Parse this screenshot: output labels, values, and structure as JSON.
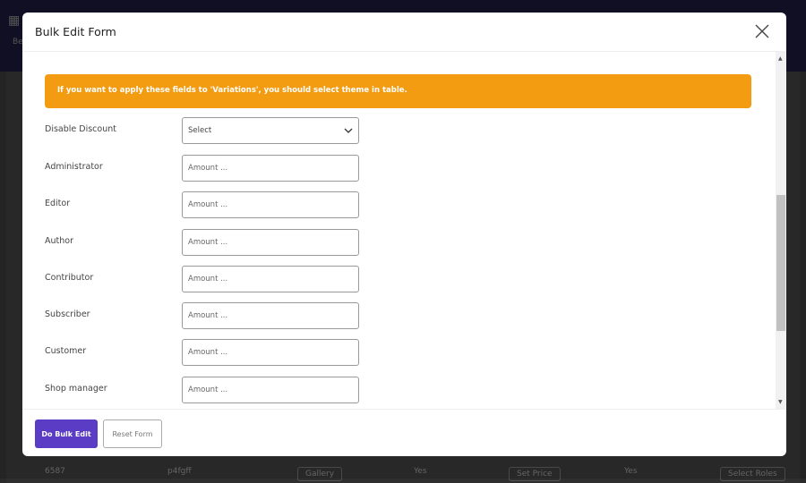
{
  "background": {
    "toolbar_label": "Be",
    "row": {
      "id": "6587",
      "name": "p4fgff",
      "gallery": "Gallery",
      "yes1": "Yes",
      "set_price": "Set Price",
      "yes2": "Yes",
      "select_roles": "Select Roles"
    }
  },
  "modal": {
    "title": "Bulk Edit Form",
    "alert": "If you want to apply these fields to 'Variations', you should select theme in table.",
    "alert_color": "#f39c12",
    "fields": [
      {
        "label": "Disable Discount",
        "type": "select",
        "value": "Select"
      },
      {
        "label": "Administrator",
        "placeholder": "Amount ..."
      },
      {
        "label": "Editor",
        "placeholder": "Amount ..."
      },
      {
        "label": "Author",
        "placeholder": "Amount ..."
      },
      {
        "label": "Contributor",
        "placeholder": "Amount ..."
      },
      {
        "label": "Subscriber",
        "placeholder": "Amount ..."
      },
      {
        "label": "Customer",
        "placeholder": "Amount ..."
      },
      {
        "label": "Shop manager",
        "placeholder": "Amount ..."
      }
    ],
    "footer": {
      "primary": "Do Bulk Edit",
      "secondary": "Reset Form",
      "primary_color": "#5b3cc4"
    }
  }
}
